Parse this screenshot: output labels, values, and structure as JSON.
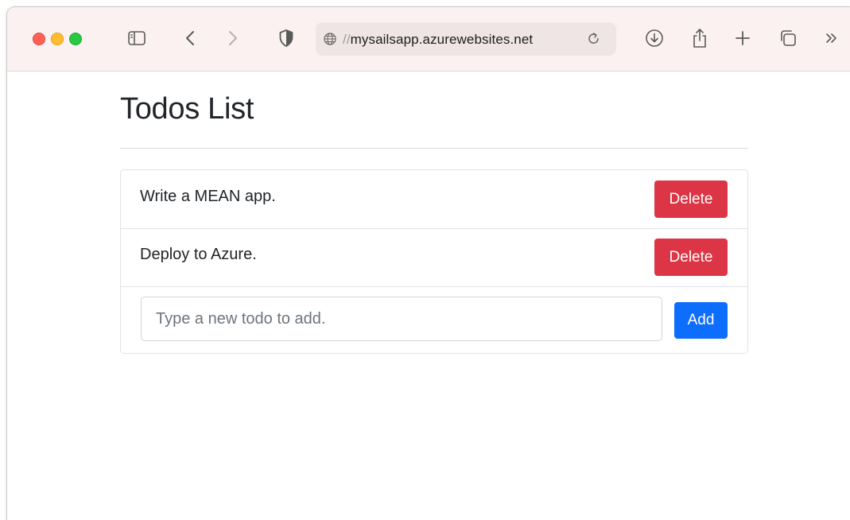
{
  "browser": {
    "url_scheme": "//",
    "url_host": "mysailsapp.azurewebsites.net",
    "icons": {
      "sidebar": "sidebar-icon",
      "back": "back-chevron-icon",
      "forward": "forward-chevron-icon",
      "privacy": "shield-icon",
      "globe": "globe-icon",
      "reload": "reload-icon",
      "downloads": "download-icon",
      "share": "share-icon",
      "new_tab": "plus-icon",
      "tab_overview": "tabs-overview-icon",
      "more": "double-chevron-right-icon"
    },
    "colors": {
      "toolbar_bg": "#fbf1f1",
      "traffic_close": "#ff5f57",
      "traffic_minimize": "#febc2e",
      "traffic_zoom": "#28c840"
    }
  },
  "page": {
    "title": "Todos List",
    "todos": [
      {
        "text": "Write a MEAN app.",
        "delete_label": "Delete"
      },
      {
        "text": "Deploy to Azure.",
        "delete_label": "Delete"
      }
    ],
    "new_todo": {
      "placeholder": "Type a new todo to add.",
      "value": "",
      "add_label": "Add"
    },
    "colors": {
      "delete_button": "#dc3545",
      "add_button": "#0d6efd",
      "text": "#212529"
    }
  }
}
